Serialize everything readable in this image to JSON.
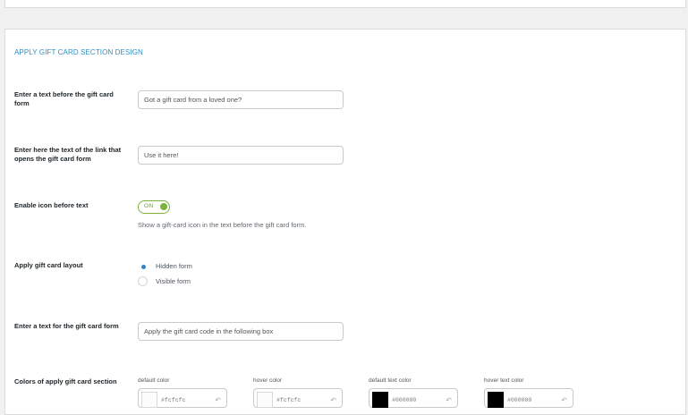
{
  "section": {
    "title": "APPLY GIFT CARD SECTION DESIGN"
  },
  "rows": {
    "text_before_form": {
      "label": "Enter a text before the gift card form",
      "value": "Got a gift card from a loved one?"
    },
    "link_text": {
      "label": "Enter here the text of the link that opens the gift card form",
      "value": "Use it here!"
    },
    "enable_icon": {
      "label": "Enable icon before text",
      "toggle_label": "ON",
      "toggle_on": true,
      "help": "Show a gift-card icon in the text before the gift card form."
    },
    "layout": {
      "label": "Apply gift card layout",
      "options": [
        "Hidden form",
        "Visible form"
      ],
      "selected": "Hidden form"
    },
    "form_text": {
      "label": "Enter a text for the gift card form",
      "value": "Apply the gift card code in the following box"
    },
    "colors": {
      "label": "Colors of apply gift card section",
      "items": [
        {
          "label": "default color",
          "hex": "#fcfcfc",
          "swatch": "#fcfcfc"
        },
        {
          "label": "hover color",
          "hex": "#fcfcfc",
          "swatch": "#fcfcfc"
        },
        {
          "label": "default text color",
          "hex": "#000000",
          "swatch": "#000000"
        },
        {
          "label": "hover text color",
          "hex": "#000000",
          "swatch": "#000000"
        }
      ],
      "reset_icon": "undo-arrow-icon"
    }
  },
  "theme": {
    "accent": "#2c8fc4",
    "toggle": "#7bb33b",
    "radio": "#3582c4"
  }
}
